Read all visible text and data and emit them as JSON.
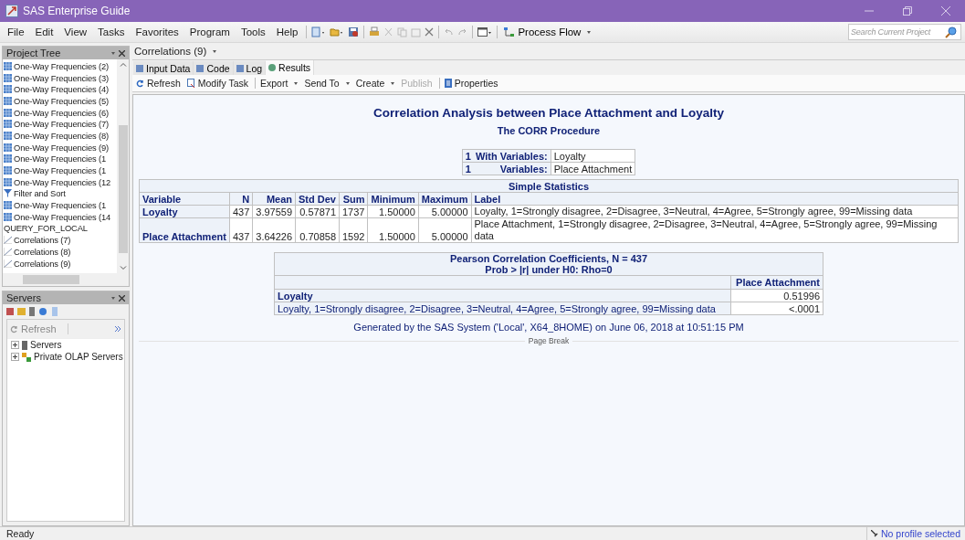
{
  "window": {
    "title": "SAS Enterprise Guide"
  },
  "menu": [
    "File",
    "Edit",
    "View",
    "Tasks",
    "Favorites",
    "Program",
    "Tools",
    "Help"
  ],
  "toolbar": {
    "process_flow": "Process Flow"
  },
  "search": {
    "placeholder": "Search Current Project"
  },
  "project_tree": {
    "title": "Project Tree",
    "items": [
      {
        "label": "One-Way Frequencies (2)",
        "kind": "freq"
      },
      {
        "label": "One-Way Frequencies (3)",
        "kind": "freq"
      },
      {
        "label": "One-Way Frequencies (4)",
        "kind": "freq"
      },
      {
        "label": "One-Way Frequencies (5)",
        "kind": "freq"
      },
      {
        "label": "One-Way Frequencies (6)",
        "kind": "freq"
      },
      {
        "label": "One-Way Frequencies (7)",
        "kind": "freq"
      },
      {
        "label": "One-Way Frequencies (8)",
        "kind": "freq"
      },
      {
        "label": "One-Way Frequencies (9)",
        "kind": "freq"
      },
      {
        "label": "One-Way Frequencies (1",
        "kind": "freq"
      },
      {
        "label": "One-Way Frequencies (1",
        "kind": "freq"
      },
      {
        "label": "One-Way Frequencies (12",
        "kind": "freq"
      },
      {
        "label": "Filter and Sort",
        "kind": "filter"
      },
      {
        "label": "One-Way Frequencies (1",
        "kind": "freq"
      },
      {
        "label": "One-Way Frequencies (14",
        "kind": "freq"
      },
      {
        "label": "QUERY_FOR_LOCAL",
        "kind": "query"
      },
      {
        "label": "Correlations (7)",
        "kind": "corr"
      },
      {
        "label": "Correlations (8)",
        "kind": "corr"
      },
      {
        "label": "Correlations (9)",
        "kind": "corr"
      }
    ]
  },
  "servers_panel": {
    "title": "Servers",
    "refresh": "Refresh",
    "items": [
      {
        "label": "Servers",
        "kind": "server",
        "expanded": false
      },
      {
        "label": "Private OLAP Servers",
        "kind": "olap",
        "expanded": false
      }
    ]
  },
  "document_tab": "Correlations (9)",
  "view_tabs": [
    {
      "label": "Input Data",
      "selected": false
    },
    {
      "label": "Code",
      "selected": false
    },
    {
      "label": "Log",
      "selected": false
    },
    {
      "label": "Results",
      "selected": true
    }
  ],
  "actions": [
    {
      "label": "Refresh",
      "kind": "refresh",
      "dropdown": false,
      "disabled": false,
      "separator_before": false
    },
    {
      "label": "Modify Task",
      "kind": "modify",
      "dropdown": false,
      "disabled": false,
      "separator_before": false
    },
    {
      "label": "Export",
      "kind": "plain",
      "dropdown": true,
      "disabled": false,
      "separator_before": true
    },
    {
      "label": "Send To",
      "kind": "plain",
      "dropdown": true,
      "disabled": false,
      "separator_before": false
    },
    {
      "label": "Create",
      "kind": "plain",
      "dropdown": true,
      "disabled": false,
      "separator_before": false
    },
    {
      "label": "Publish",
      "kind": "plain",
      "dropdown": false,
      "disabled": true,
      "separator_before": false
    },
    {
      "label": "Properties",
      "kind": "properties",
      "dropdown": false,
      "disabled": false,
      "separator_before": true
    }
  ],
  "report": {
    "title": "Correlation Analysis between Place Attachment and Loyalty",
    "subtitle": "The CORR Procedure",
    "variables": [
      {
        "count": "1",
        "label": "With Variables:",
        "value": "Loyalty"
      },
      {
        "count": "1",
        "label": "Variables:",
        "value": "Place Attachment"
      }
    ],
    "simple_statistics": {
      "title": "Simple Statistics",
      "columns": [
        "Variable",
        "N",
        "Mean",
        "Std Dev",
        "Sum",
        "Minimum",
        "Maximum",
        "Label"
      ],
      "rows": [
        [
          "Loyalty",
          "437",
          "3.97559",
          "0.57871",
          "1737",
          "1.50000",
          "5.00000",
          "Loyalty, 1=Strongly disagree, 2=Disagree, 3=Neutral, 4=Agree, 5=Strongly agree, 99=Missing data"
        ],
        [
          "Place Attachment",
          "437",
          "3.64226",
          "0.70858",
          "1592",
          "1.50000",
          "5.00000",
          "Place Attachment, 1=Strongly disagree, 2=Disagree, 3=Neutral, 4=Agree, 5=Strongly agree, 99=Missing data"
        ]
      ]
    },
    "pearson": {
      "title": "Pearson Correlation Coefficients, N = 437",
      "subtitle": "Prob > |r| under H0: Rho=0",
      "column": "Place Attachment",
      "row_name": "Loyalty",
      "coefficient": "0.51996",
      "row_label": "Loyalty, 1=Strongly disagree, 2=Disagree, 3=Neutral, 4=Agree, 5=Strongly agree, 99=Missing data",
      "p_value": "<.0001"
    },
    "footer": "Generated by the SAS System ('Local', X64_8HOME) on June 06, 2018 at 10:51:15 PM",
    "page_break": "Page Break"
  },
  "status_bar": {
    "left": "Ready",
    "right": "No profile selected"
  }
}
